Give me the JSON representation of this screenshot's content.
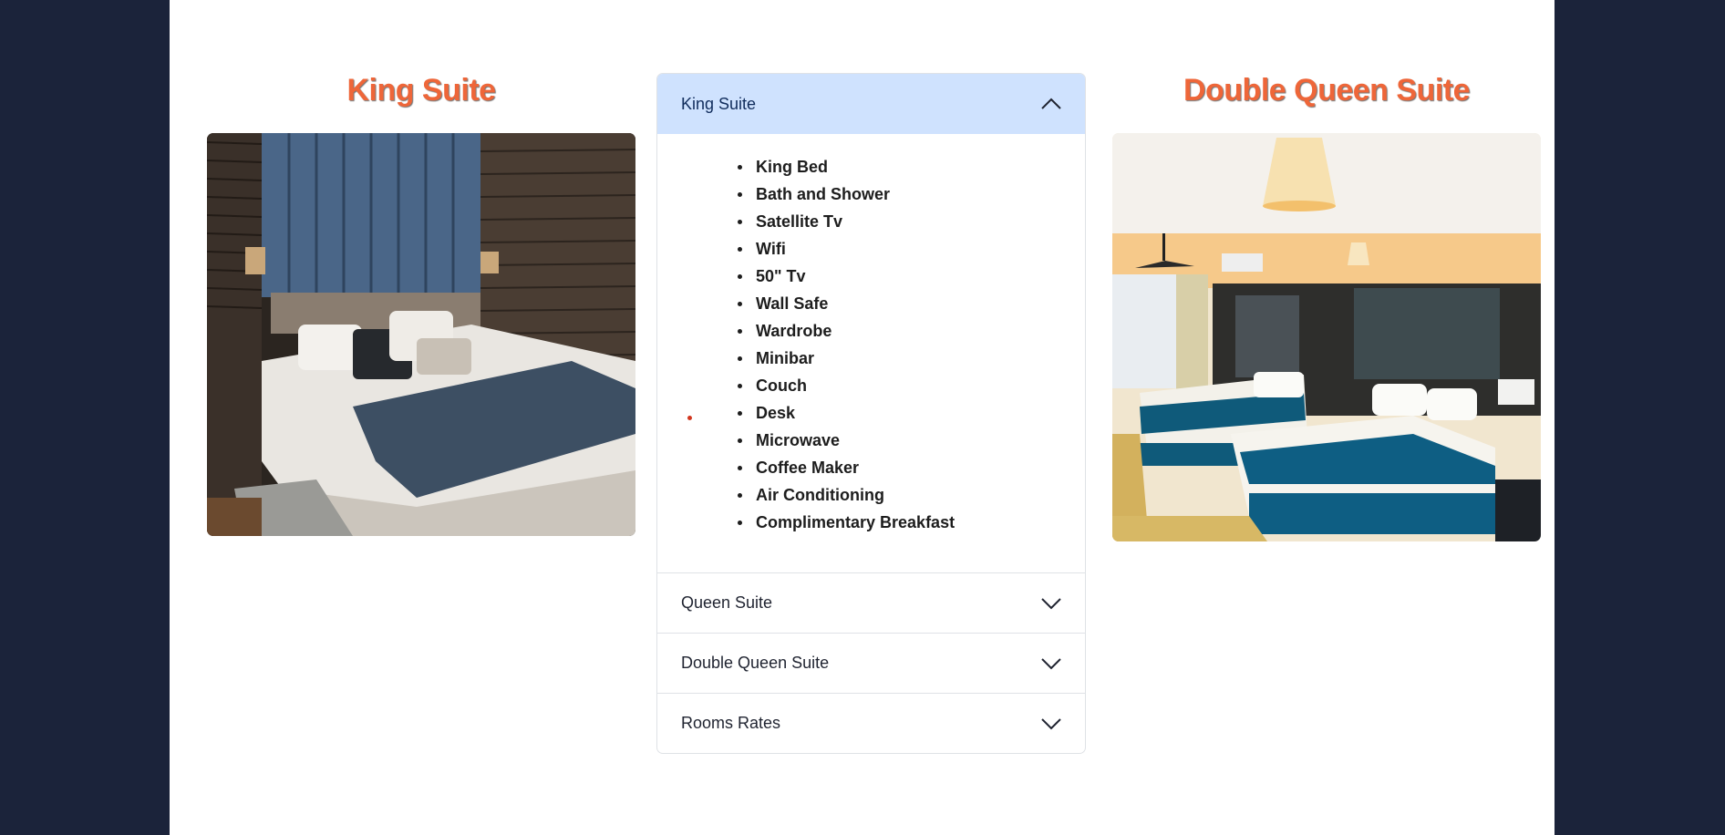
{
  "left_column": {
    "title": "King Suite",
    "image_name": "king-suite-bedroom-photo"
  },
  "right_column": {
    "title": "Double Queen Suite",
    "image_name": "double-queen-suite-bedroom-photo"
  },
  "accordion": {
    "sections": [
      {
        "label": "King Suite",
        "expanded": true,
        "icon": "chevron-up-icon",
        "items": [
          "King Bed",
          "Bath and Shower",
          "Satellite Tv",
          "Wifi",
          "50\" Tv",
          "Wall Safe",
          "Wardrobe",
          "Minibar",
          "Couch",
          "Desk",
          "Microwave",
          "Coffee Maker",
          "Air Conditioning",
          "Complimentary Breakfast"
        ]
      },
      {
        "label": "Queen Suite",
        "expanded": false,
        "icon": "chevron-down-icon"
      },
      {
        "label": "Double Queen Suite",
        "expanded": false,
        "icon": "chevron-down-icon"
      },
      {
        "label": "Rooms Rates",
        "expanded": false,
        "icon": "chevron-down-icon"
      }
    ]
  },
  "colors": {
    "background": "#1b233a",
    "title_accent": "#ee6639",
    "active_header": "#cfe2fe"
  }
}
